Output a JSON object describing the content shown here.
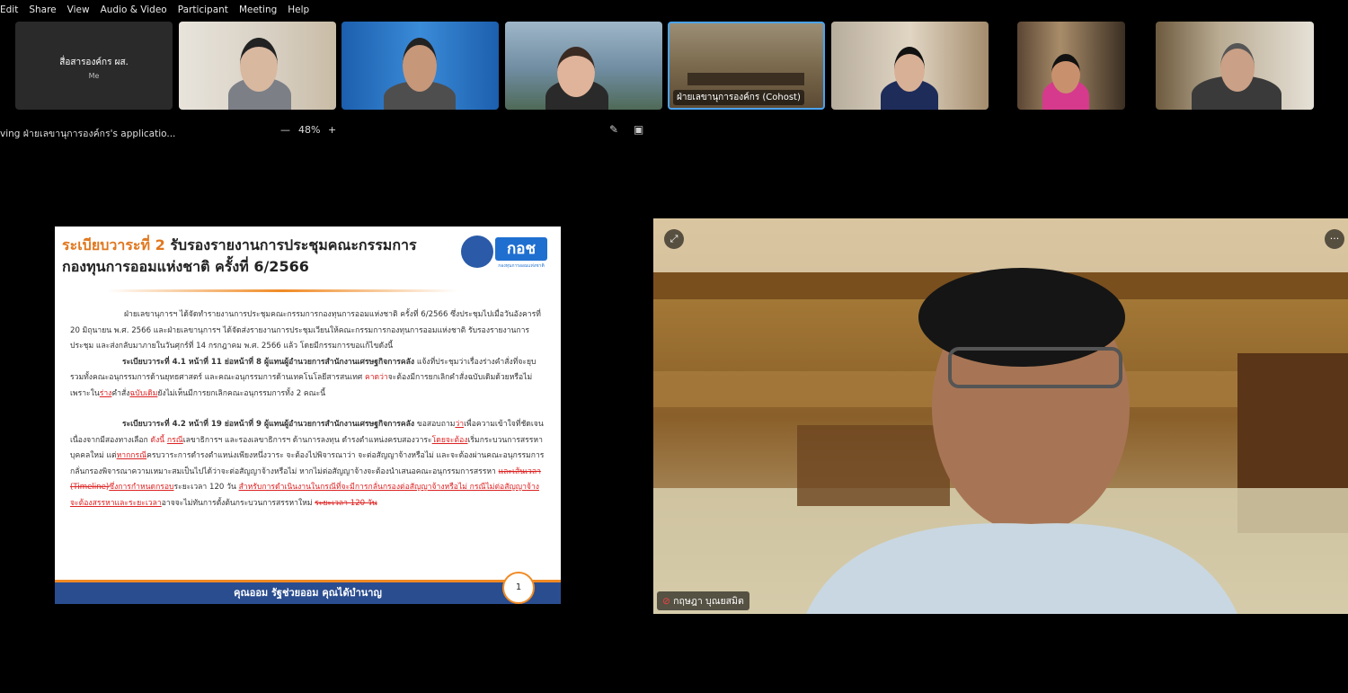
{
  "menu": [
    "Edit",
    "Share",
    "View",
    "Audio & Video",
    "Participant",
    "Meeting",
    "Help"
  ],
  "thumbnails": [
    {
      "name": "สื่อสารองค์กร ผส.",
      "sub": "Me"
    },
    {
      "label": ""
    },
    {
      "label": ""
    },
    {
      "label": ""
    },
    {
      "label": "ฝ่ายเลขานุการองค์กร (Cohost)"
    },
    {
      "label": ""
    },
    {
      "label": ""
    },
    {
      "label": ""
    }
  ],
  "share": {
    "title": "ving ฝ่ายเลขานุการองค์กร's applicatio...",
    "zoom_minus": "—",
    "zoom": "48%",
    "zoom_plus": "+"
  },
  "slide": {
    "heading_prefix": "ระเบียบวาระที่ 2",
    "heading_rest": " รับรองรายงานการประชุมคณะกรรมการกองทุนการออมแห่งชาติ ครั้งที่ 6/2566",
    "logo_text": "กอช",
    "logo_sub": "กองทุนการออมแห่งชาติ",
    "p1": "ฝ่ายเลขานุการฯ ได้จัดทำรายงานการประชุมคณะกรรมการกองทุนการออมแห่งชาติ ครั้งที่ 6/2566 ซึ่งประชุมไปเมื่อวันอังคารที่ 20 มิถุนายน พ.ศ. 2566 และฝ่ายเลขานุการฯ ได้จัดส่งรายงานการประชุมเวียนให้คณะกรรมการกองทุนการออมแห่งชาติ รับรองรายงานการประชุม และส่งกลับมาภายในวันศุกร์ที่ 14 กรกฎาคม พ.ศ. 2566 แล้ว โดยมีกรรมการขอแก้ไขดังนี้",
    "p2_bold": "ระเบียบวาระที่ 4.1 หน้าที่ 11 ย่อหน้าที่ 8 ผู้แทนผู้อำนวยการสำนักงานเศรษฐกิจการคลัง",
    "p2_a": " แจ้งที่ประชุมว่าเรื่องร่างคำสั่งที่จะยุบรวมทั้งคณะอนุกรรมการด้านยุทธศาสตร์ และคณะอนุกรรมการด้านเทคโนโลยีสารสนเทศ ",
    "p2_red1": "คาดว่า",
    "p2_b": "จะต้องมีการยกเลิกคำสั่งฉบับเดิมด้วยหรือไม่ เพราะใน",
    "p2_red2": "ร่าง",
    "p2_c": "คำสั่ง",
    "p2_red3": "ฉบับเดิม",
    "p2_d": "ยังไม่เห็นมีการยกเลิกคณะอนุกรรมการทั้ง 2 คณะนี้",
    "p3_bold": "ระเบียบวาระที่ 4.2 หน้าที่ 19 ย่อหน้าที่ 9 ผู้แทนผู้อำนวยการสำนักงานเศรษฐกิจการคลัง",
    "p3_a": " ขอสอบถาม",
    "p3_red1": "ว่า",
    "p3_b": "เพื่อความเข้าใจที่ชัดเจนเนื่องจากมีสองทางเลือก ",
    "p3_red2": "ดังนี้",
    "p3_c": " ",
    "p3_red3": "กรณี",
    "p3_d": "เลขาธิการฯ และรองเลขาธิการฯ ด้านการลงทุน ดำรงตำแหน่งครบสองวาระ",
    "p3_red4": "โดยจะต้อง",
    "p3_e": "เริ่มกระบวนการสรรหาบุคคลใหม่ แต่",
    "p3_red5": "หากกรณี",
    "p3_f": "ครบวาระการดำรงตำแหน่งเพียงหนึ่งวาระ จะต้องไปพิจารณาว่า จะต่อสัญญาจ้างหรือไม่ และจะต้องผ่านคณะอนุกรรมการกลั่นกรองพิจารณาความเหมาะสมเป็นไปได้ว่าจะต่อสัญญาจ้างหรือไม่ หากไม่ต่อสัญญาจ้างจะต้องนำเสนอคณะอนุกรรมการสรรหา ",
    "p3_strike1": "และเส้นเวลา (Timeline)",
    "p3_red6": "ซึ่งการกำหนดกรอบ",
    "p3_g": "ระยะเวลา 120 วัน ",
    "p3_red7": "สำหรับการดำเนินงานในกรณีที่จะมีการกลั่นกรองต่อสัญญาจ้างหรือไม่ กรณีไม่ต่อสัญญาจ้างจะต้องสรรหาและระยะเวลา",
    "p3_h": "อาจจะไม่ทันการตั้งต้นกระบวนการสรรหาใหม่ ",
    "p3_strike2": "ระยะเวลา 120 วัน",
    "page_number": "1",
    "footer": "คุณออม รัฐช่วยออม คุณได้บำนาญ"
  },
  "video": {
    "name": "กฤษฎา บุณยสมิต",
    "unpin_icon": "⤢",
    "more_icon": "···"
  }
}
